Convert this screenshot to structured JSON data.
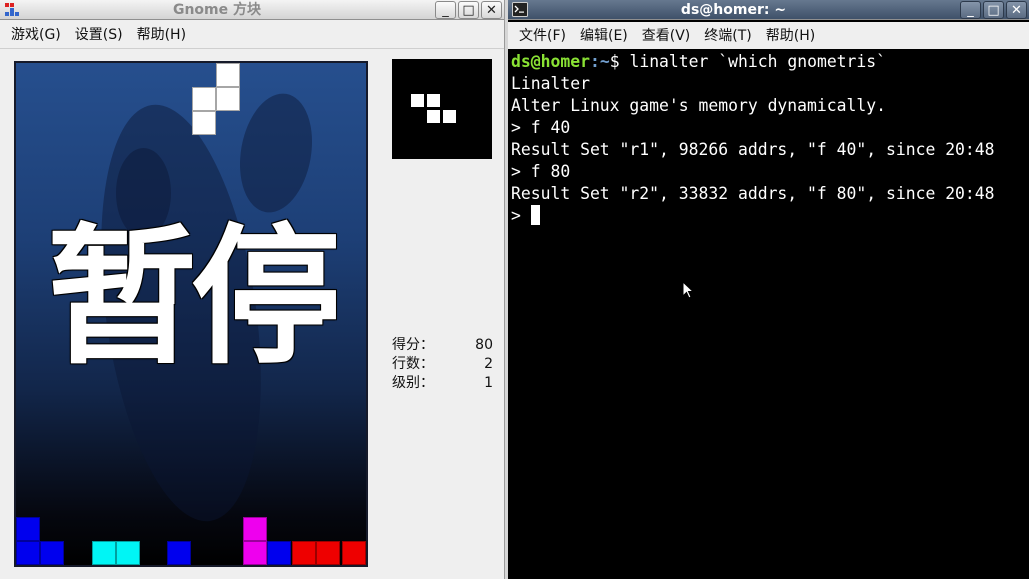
{
  "gnome_window": {
    "title": "Gnome 方块",
    "buttons": {
      "minimize": "_",
      "maximize": "□",
      "close": "✕"
    },
    "menu": [
      "游戏(G)",
      "设置(S)",
      "帮助(H)"
    ],
    "paused_text": "暂停",
    "stats": [
      {
        "label": "得分：",
        "value": "80"
      },
      {
        "label": "行数：",
        "value": "2"
      },
      {
        "label": "级别：",
        "value": "1"
      }
    ],
    "colors": {
      "blue": "#0000ee",
      "cyan": "#00f5f5",
      "magenta": "#ee00ee",
      "red": "#ee0000",
      "white": "#ffffff"
    }
  },
  "terminal_window": {
    "title": "ds@homer: ~",
    "buttons": {
      "minimize": "_",
      "maximize": "□",
      "close": "✕"
    },
    "menu": [
      "文件(F)",
      "编辑(E)",
      "查看(V)",
      "终端(T)",
      "帮助(H)"
    ],
    "prompt_user": "ds@homer",
    "prompt_path": ":~",
    "prompt_symbol": "$ ",
    "command": "linalter `which gnometris`",
    "lines": [
      "Linalter",
      "Alter Linux game's memory dynamically.",
      "> f 40",
      "Result Set \"r1\", 98266 addrs, \"f 40\", since 20:48",
      "> f 80",
      "Result Set \"r2\", 33832 addrs, \"f 80\", since 20:48"
    ],
    "input_prompt": "> "
  }
}
